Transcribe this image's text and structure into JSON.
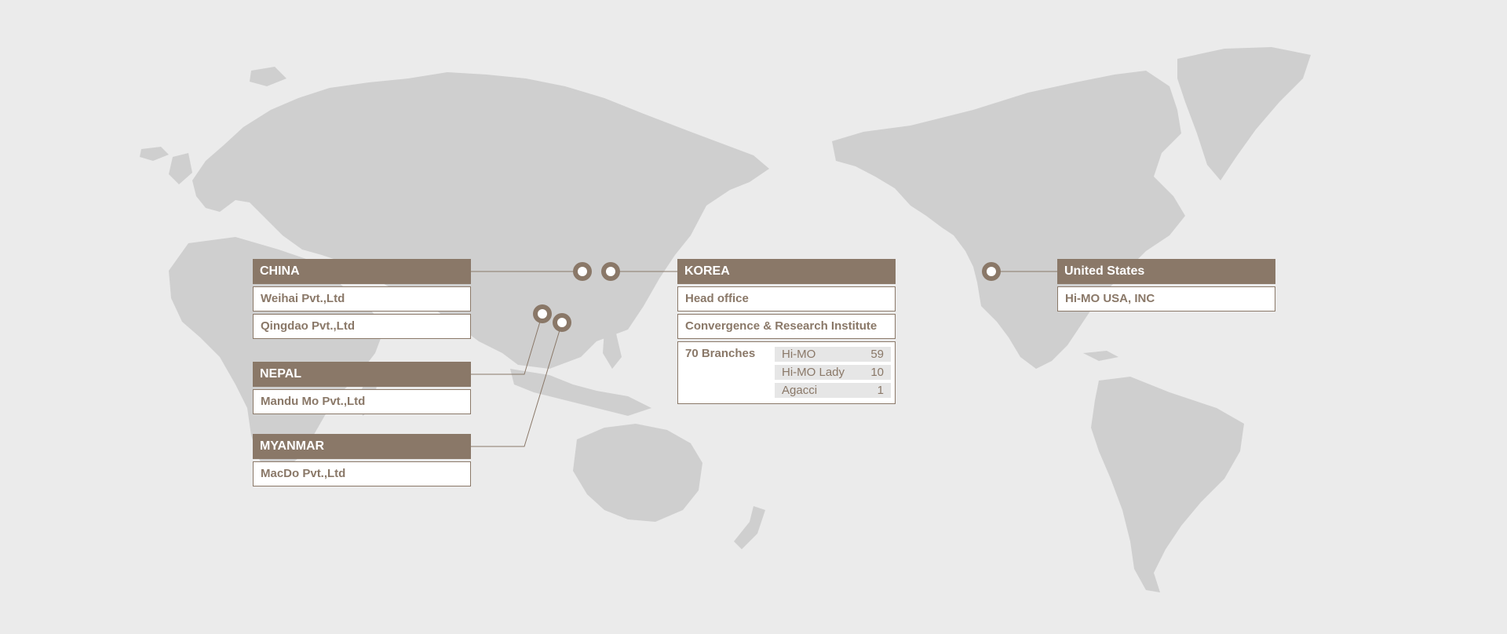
{
  "colors": {
    "background": "#ebebeb",
    "land": "#cfcfcf",
    "accent": "#8a7868",
    "box": "#ffffff",
    "brand_bg": "#e6e6e6"
  },
  "china": {
    "title": "CHINA",
    "items": [
      "Weihai Pvt.,Ltd",
      "Qingdao Pvt.,Ltd"
    ]
  },
  "nepal": {
    "title": "NEPAL",
    "items": [
      "Mandu Mo Pvt.,Ltd"
    ]
  },
  "myanmar": {
    "title": "MYANMAR",
    "items": [
      "MacDo Pvt.,Ltd"
    ]
  },
  "korea": {
    "title": "KOREA",
    "items": [
      "Head office",
      "Convergence  & Research Institute"
    ],
    "branches_label": "70 Branches",
    "brands": [
      {
        "name": "Hi-MO",
        "count": "59"
      },
      {
        "name": "Hi-MO Lady",
        "count": "10"
      },
      {
        "name": "Agacci",
        "count": "1"
      }
    ]
  },
  "usa": {
    "title": "United States",
    "items": [
      "Hi-MO USA, INC"
    ]
  },
  "markers": [
    "marker-china",
    "marker-korea",
    "marker-nepal",
    "marker-myanmar",
    "marker-usa"
  ]
}
